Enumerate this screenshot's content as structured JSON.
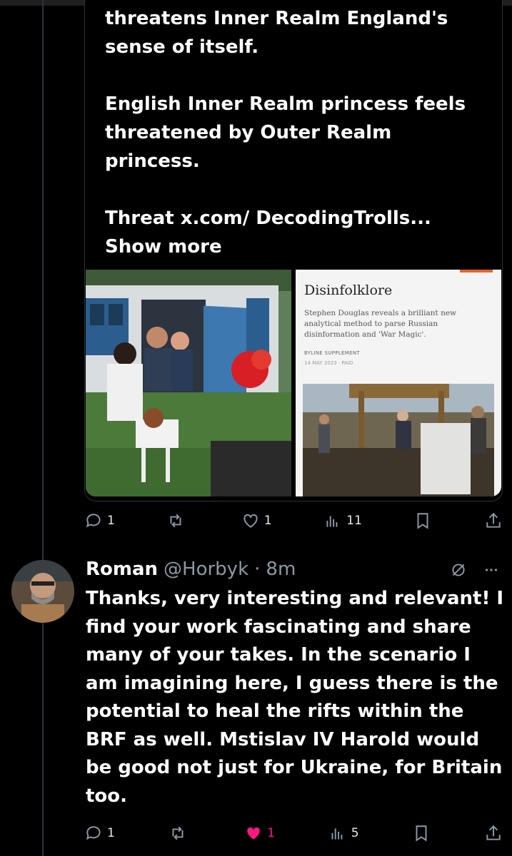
{
  "quoted_tweet": {
    "paragraphs": [
      "threatens Inner Realm England's sense of itself.",
      "English Inner Realm princess feels threatened by Outer Realm princess.",
      "Threat x.com/ DecodingTrolls..."
    ],
    "show_more_label": "Show more",
    "article_card": {
      "title": "Disinfolklore",
      "subtitle": "Stephen Douglas reveals a brilliant new analytical method to parse Russian disinformation and 'War Magic'.",
      "byline": "BYLINE SUPPLEMENT",
      "date": "14 MAY 2023 · PAID"
    }
  },
  "tweet1_actions": {
    "replies": "1",
    "reposts": "",
    "likes": "1",
    "views": "11"
  },
  "reply": {
    "name": "Roman",
    "handle": "@Horbyk",
    "separator": "·",
    "time": "8m",
    "text": "Thanks, very interesting and relevant! I find your work fascinating and share many of your takes. In the scenario I am imagining here, I guess there is the potential to heal the rifts within the BRF as well. Mstislav IV Harold would be good not just for Ukraine, for Britain too.",
    "actions": {
      "replies": "1",
      "reposts": "",
      "likes": "1",
      "views": "5"
    }
  },
  "colors": {
    "background": "#000000",
    "text": "#e7e9ea",
    "muted": "#8b98a5",
    "like_pink": "#f91880",
    "border": "#2f3336"
  },
  "icons": [
    "reply-icon",
    "repost-icon",
    "like-icon",
    "views-icon",
    "bookmark-icon",
    "share-icon",
    "grok-icon",
    "more-icon"
  ]
}
